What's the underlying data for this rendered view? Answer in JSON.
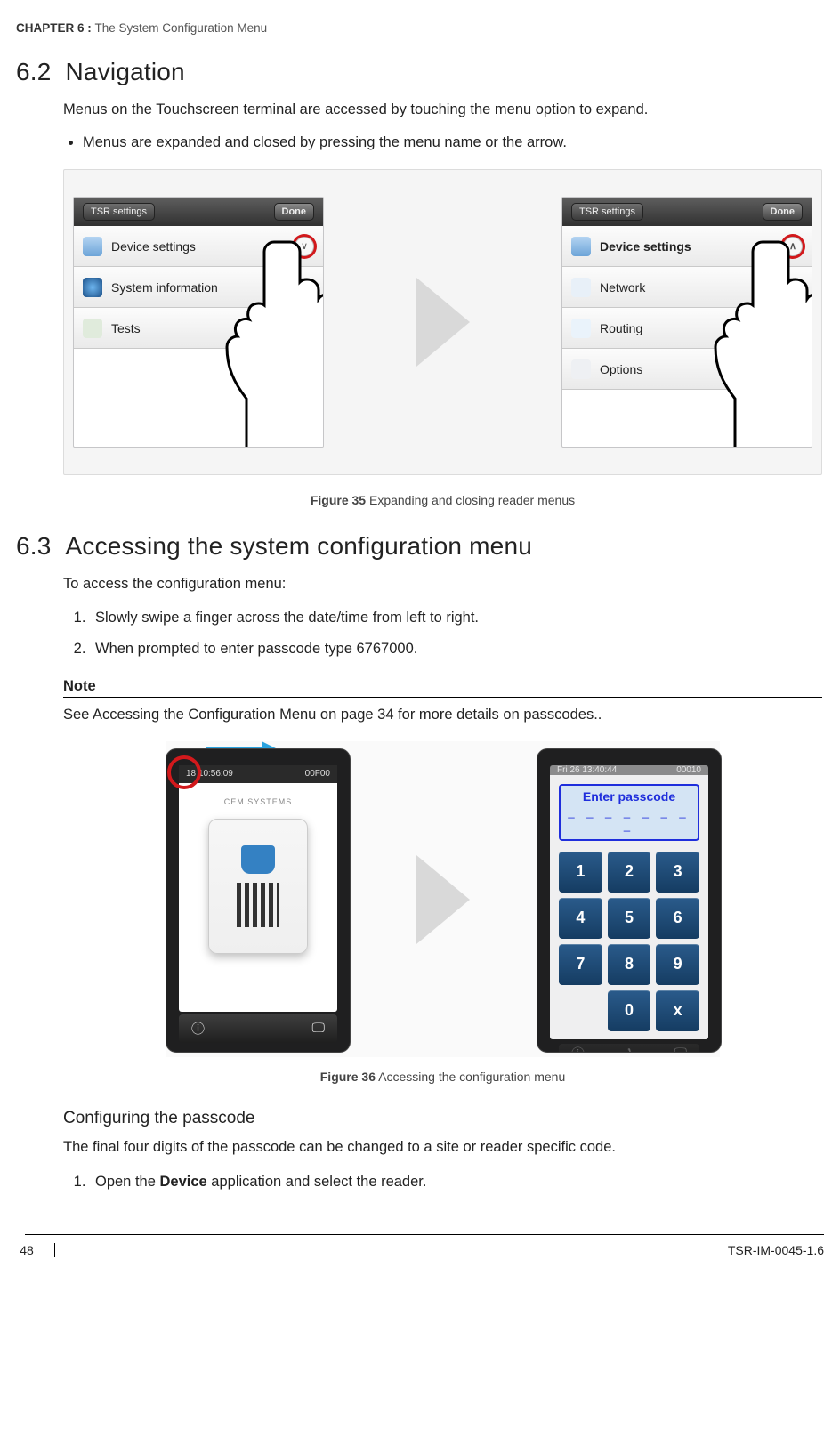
{
  "chapter": {
    "label": "CHAPTER  6 : ",
    "title": "The System Configuration Menu"
  },
  "sections": {
    "nav": {
      "number": "6.2",
      "title": "Navigation",
      "para": "Menus on the Touchscreen terminal are accessed by touching the menu option to expand.",
      "bullet": "Menus are expanded and closed by pressing the menu name or the arrow."
    },
    "access": {
      "number": "6.3",
      "title": "Accessing the system configuration menu",
      "para": "To access the configuration menu:",
      "steps": [
        "Slowly swipe a finger across the date/time from left to right.",
        "When prompted to enter passcode type 6767000."
      ]
    }
  },
  "figure35": {
    "caption_label": "Figure 35",
    "caption_text": " Expanding and closing reader menus",
    "left": {
      "tsr": "TSR settings",
      "done": "Done",
      "items": [
        "Device settings",
        "System information",
        "Tests"
      ],
      "chev": "∨"
    },
    "right": {
      "tsr": "TSR settings",
      "done": "Done",
      "items": [
        "Device settings",
        "Network",
        "Routing",
        "Options"
      ],
      "chev": "∧"
    }
  },
  "note": {
    "label": "Note",
    "text": "See Accessing the Configuration Menu on page 34 for more details on passcodes.."
  },
  "figure36": {
    "status_left": "18  10:56:09",
    "status_right": "00F00",
    "cem": "CEM SYSTEMS",
    "caption_label": "Figure 36",
    "caption_text": " Accessing the configuration menu",
    "enter_passcode": "Enter passcode",
    "dashes": "_ _ _ _ _ _ _ _",
    "keys": [
      "1",
      "2",
      "3",
      "4",
      "5",
      "6",
      "7",
      "8",
      "9",
      "",
      "0",
      "x"
    ],
    "ghost_status_left": "Fri 26  13:40:44",
    "ghost_status_right": "00010"
  },
  "config_passcode": {
    "heading": "Configuring the passcode",
    "para": "The final four digits of the passcode can be changed to a site or reader specific code.",
    "step_pre": "Open the ",
    "step_bold": "Device",
    "step_post": " application and select the reader."
  },
  "footer": {
    "page": "48",
    "doc": "TSR-IM-0045-1.6"
  }
}
